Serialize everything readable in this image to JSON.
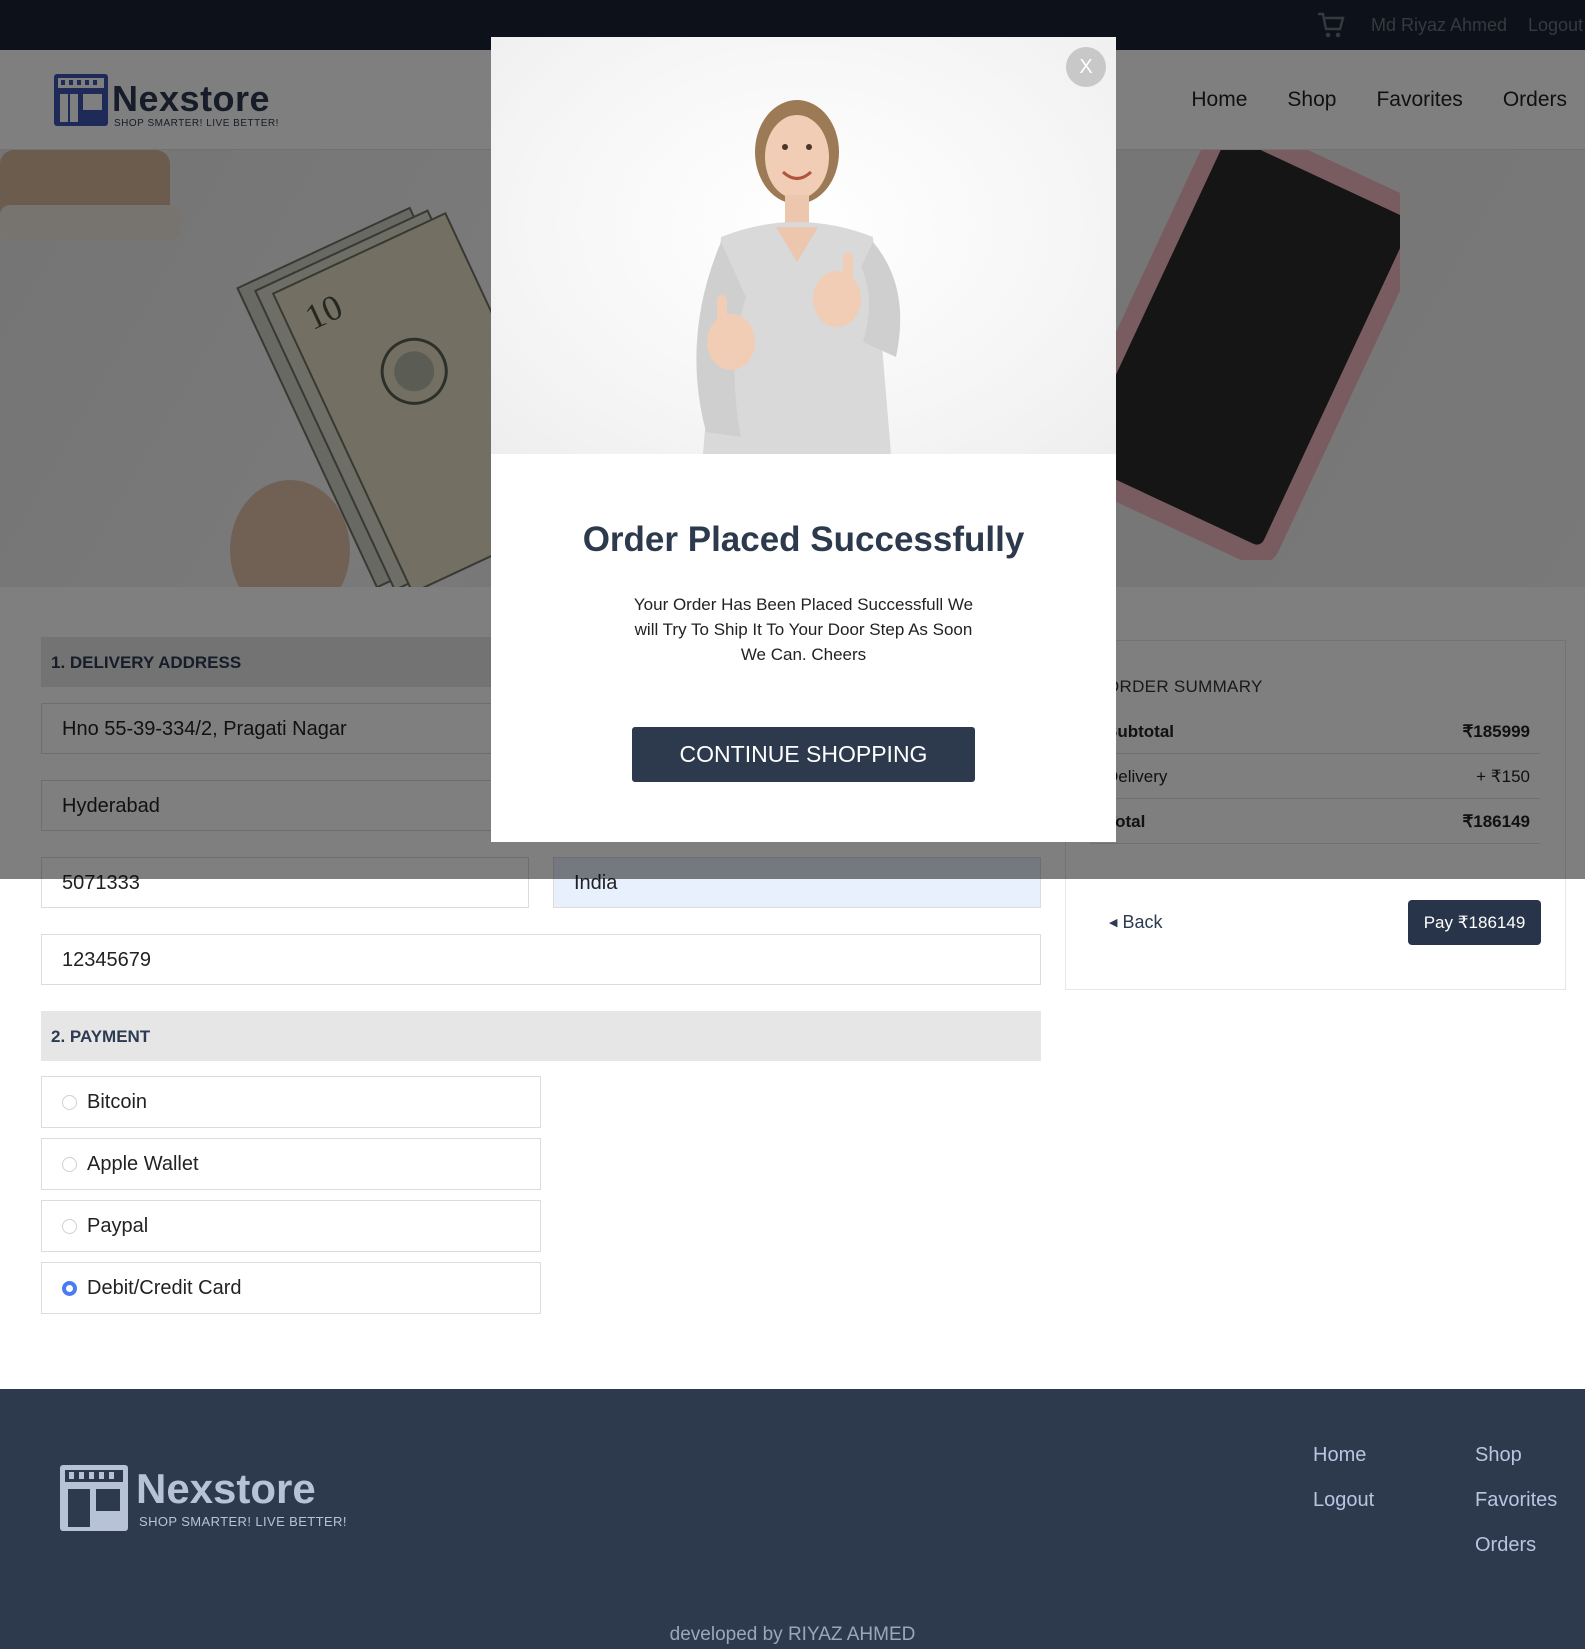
{
  "topbar": {
    "user_name": "Md Riyaz Ahmed",
    "logout_label": "Logout"
  },
  "header": {
    "brand": "Nexstore",
    "tagline": "SHOP SMARTER! LIVE BETTER!",
    "nav": [
      "Home",
      "Shop",
      "Favorites",
      "Orders"
    ]
  },
  "delivery": {
    "heading": "1. DELIVERY ADDRESS",
    "address": "Hno 55-39-334/2, Pragati Nagar",
    "city": "Hyderabad",
    "zip": "5071333",
    "country": "India",
    "phone": "12345679"
  },
  "payment": {
    "heading": "2. PAYMENT",
    "options": [
      "Bitcoin",
      "Apple Wallet",
      "Paypal",
      "Debit/Credit Card"
    ],
    "selected": "Debit/Credit Card"
  },
  "summary": {
    "title": "ORDER SUMMARY",
    "rows": [
      {
        "label": "Subtotal",
        "value": "₹185999"
      },
      {
        "label": "Delivery",
        "value": "+ ₹150"
      },
      {
        "label": "Total",
        "value": "₹186149"
      }
    ],
    "back_label": "Back",
    "pay_label": "Pay ₹186149"
  },
  "modal": {
    "close_label": "X",
    "title": "Order Placed Successfully",
    "text": "Your Order Has Been Placed Successfull We will Try To Ship It To Your Door Step As Soon We Can. Cheers",
    "button_label": "CONTINUE SHOPPING"
  },
  "footer": {
    "brand": "Nexstore",
    "tagline": "SHOP SMARTER! LIVE BETTER!",
    "links_col1": [
      "Home",
      "Logout"
    ],
    "links_col2": [
      "Shop",
      "Favorites",
      "Orders"
    ],
    "credit": "developed by RIYAZ AHMED"
  },
  "colors": {
    "navy": "#2d3a4d",
    "topbar": "#1a2232",
    "accent_radio": "#4a7bf0"
  }
}
